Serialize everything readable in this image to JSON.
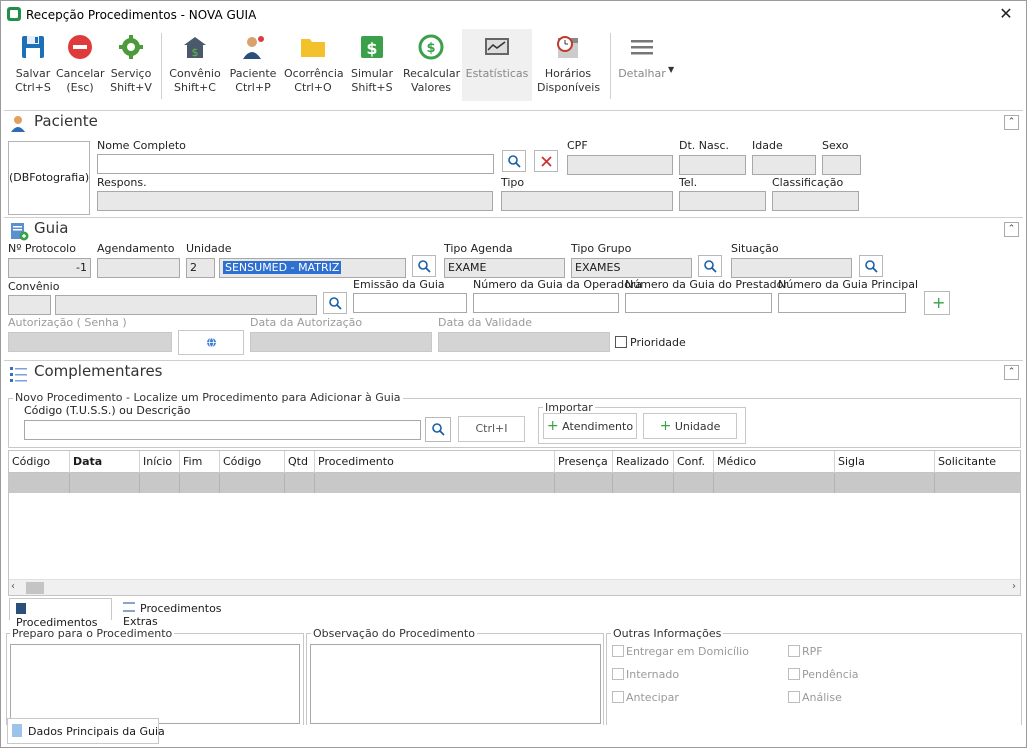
{
  "window": {
    "title": "Recepção Procedimentos - NOVA GUIA",
    "close": "✕"
  },
  "toolbar": {
    "salvar": [
      "Salvar",
      "Ctrl+S"
    ],
    "cancelar": [
      "Cancelar",
      "(Esc)"
    ],
    "servico": [
      "Serviço",
      "Shift+V"
    ],
    "convenio": [
      "Convênio",
      "Shift+C"
    ],
    "paciente": [
      "Paciente",
      "Ctrl+P"
    ],
    "ocorrencia": [
      "Ocorrência",
      "Ctrl+O"
    ],
    "simular": [
      "Simular",
      "Shift+S"
    ],
    "recalcular": [
      "Recalcular",
      "Valores"
    ],
    "estatisticas": [
      "Estatísticas"
    ],
    "horarios": [
      "Horários",
      "Disponíveis"
    ],
    "detalhar": [
      "Detalhar"
    ]
  },
  "paciente": {
    "title": "Paciente",
    "photo": "(DBFotografia)",
    "nome_label": "Nome Completo",
    "nome_value": "",
    "cpf_label": "CPF",
    "nasc_label": "Dt. Nasc.",
    "idade_label": "Idade",
    "sexo_label": "Sexo",
    "respons_label": "Respons.",
    "tipo_label": "Tipo",
    "tel_label": "Tel.",
    "class_label": "Classificação"
  },
  "guia": {
    "title": "Guia",
    "protocolo_label": "Nº Protocolo",
    "protocolo_value": "-1",
    "agend_label": "Agendamento",
    "unidade_label": "Unidade",
    "unidade_code": "2",
    "unidade_name": "SENSUMED - MATRIZ",
    "tipo_agenda_label": "Tipo Agenda",
    "tipo_agenda_value": "EXAME",
    "tipo_grupo_label": "Tipo Grupo",
    "tipo_grupo_value": "EXAMES",
    "situacao_label": "Situação",
    "convenio_label": "Convênio",
    "emissao_label": "Emissão da Guia",
    "num_operadora_label": "Número da Guia da Operadora",
    "num_prestador_label": "Número da Guia do Prestador",
    "num_principal_label": "Número da Guia Principal",
    "autorizacao_label": "Autorização ( Senha )",
    "data_autorizacao_label": "Data da Autorização",
    "data_validade_label": "Data da Validade",
    "prioridade_label": "Prioridade"
  },
  "complementares": {
    "title": "Complementares",
    "novo_proc_label": "Novo Procedimento - Localize um Procedimento para Adicionar à Guia",
    "codigo_label": "Código (T.U.S.S.) ou Descrição",
    "ctrl_i": "Ctrl+I",
    "importar_label": "Importar",
    "atendimento_btn": "Atendimento",
    "unidade_btn": "Unidade"
  },
  "grid": {
    "columns": [
      "Código",
      "Data",
      "Início",
      "Fim",
      "Código",
      "Qtd",
      "Procedimento",
      "Presença",
      "Realizado",
      "Conf.",
      "Médico",
      "Sigla",
      "Solicitante"
    ]
  },
  "tabs": {
    "procedimentos": "Procedimentos",
    "extras": "Procedimentos Extras"
  },
  "bottom": {
    "preparo_label": "Preparo para o Procedimento",
    "observacao_label": "Observação do Procedimento",
    "outras_label": "Outras Informações",
    "entregar": "Entregar em Domicílio",
    "internado": "Internado",
    "antecipar": "Antecipar",
    "rpf": "RPF",
    "pendencia": "Pendência",
    "analise": "Análise",
    "dados_principais": "Dados Principais da Guia"
  }
}
